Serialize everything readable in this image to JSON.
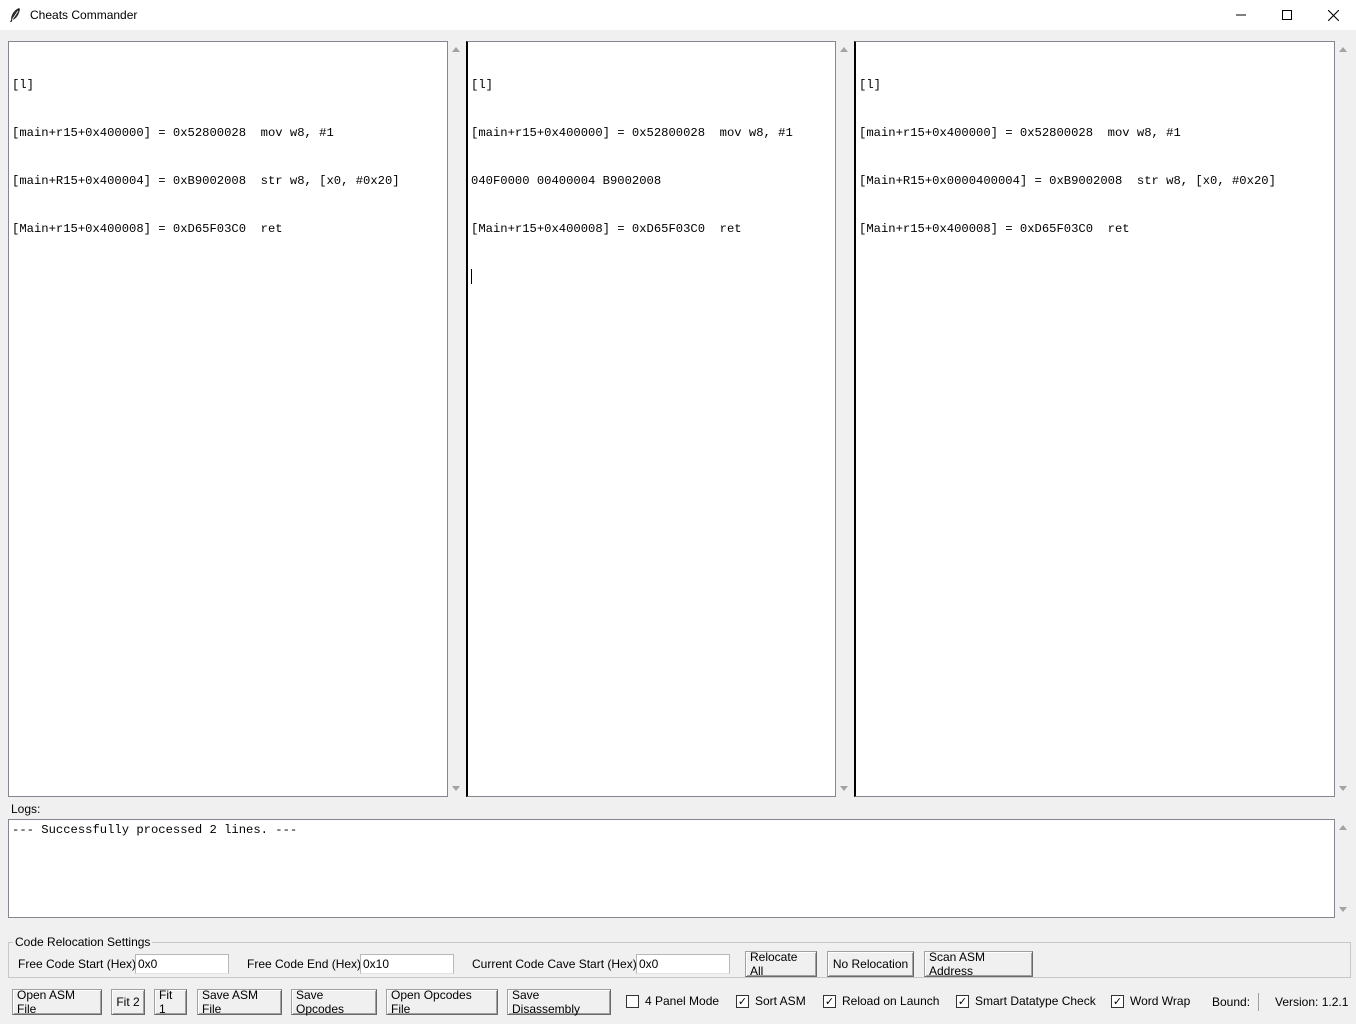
{
  "window": {
    "title": "Cheats Commander",
    "icon": "feather-icon",
    "controls": [
      "minimize-icon",
      "maximize-icon",
      "close-icon"
    ]
  },
  "panels": [
    {
      "lines": [
        "[l]",
        "[main+r15+0x400000] = 0x52800028  mov w8, #1",
        "[main+R15+0x400004] = 0xB9002008  str w8, [x0, #0x20]",
        "[Main+r15+0x400008] = 0xD65F03C0  ret"
      ]
    },
    {
      "lines": [
        "[l]",
        "[main+r15+0x400000] = 0x52800028  mov w8, #1",
        "040F0000 00400004 B9002008",
        "[Main+r15+0x400008] = 0xD65F03C0  ret"
      ]
    },
    {
      "lines": [
        "[l]",
        "[main+r15+0x400000] = 0x52800028  mov w8, #1",
        "[Main+R15+0x0000400004] = 0xB9002008  str w8, [x0, #0x20]",
        "[Main+r15+0x400008] = 0xD65F03C0  ret"
      ]
    }
  ],
  "logs": {
    "label": "Logs:",
    "text": "--- Successfully processed 2 lines. ---"
  },
  "relocation": {
    "group_title": "Code Relocation Settings",
    "free_start_label": "Free Code Start (Hex):",
    "free_start_value": "0x0",
    "free_end_label": "Free Code End (Hex):",
    "free_end_value": "0x10",
    "cave_start_label": "Current Code Cave Start (Hex):",
    "cave_start_value": "0x0",
    "relocate_all": "Relocate All",
    "no_relocation": "No Relocation",
    "scan_asm": "Scan ASM Address"
  },
  "toolbar": {
    "open_asm": "Open ASM File",
    "fit2": "Fit 2",
    "fit1": "Fit 1",
    "save_asm": "Save ASM File",
    "save_opcodes": "Save Opcodes",
    "open_opcodes": "Open Opcodes File",
    "save_disassembly": "Save Disassembly",
    "four_panel": {
      "label": "4 Panel Mode",
      "checked": false
    },
    "sort_asm": {
      "label": "Sort ASM",
      "checked": true
    },
    "reload_launch": {
      "label": "Reload on Launch",
      "checked": true
    },
    "smart_datatype": {
      "label": "Smart Datatype Check",
      "checked": true
    },
    "word_wrap": {
      "label": "Word Wrap",
      "checked": true
    },
    "bound_label": "Bound:",
    "version": "Version: 1.2.1"
  }
}
